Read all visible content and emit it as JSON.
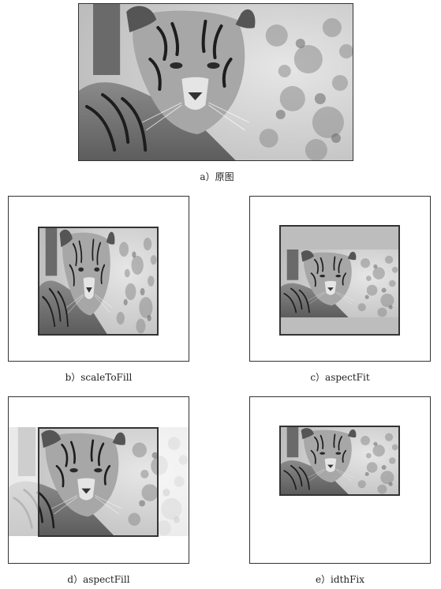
{
  "figure": {
    "panels": [
      {
        "id": "a",
        "caption": "a）原图"
      },
      {
        "id": "b",
        "caption": "b）scaleToFill"
      },
      {
        "id": "c",
        "caption": "c）aspectFit"
      },
      {
        "id": "d",
        "caption": "d）aspectFill"
      },
      {
        "id": "e",
        "caption": "e）idthFix"
      }
    ]
  }
}
